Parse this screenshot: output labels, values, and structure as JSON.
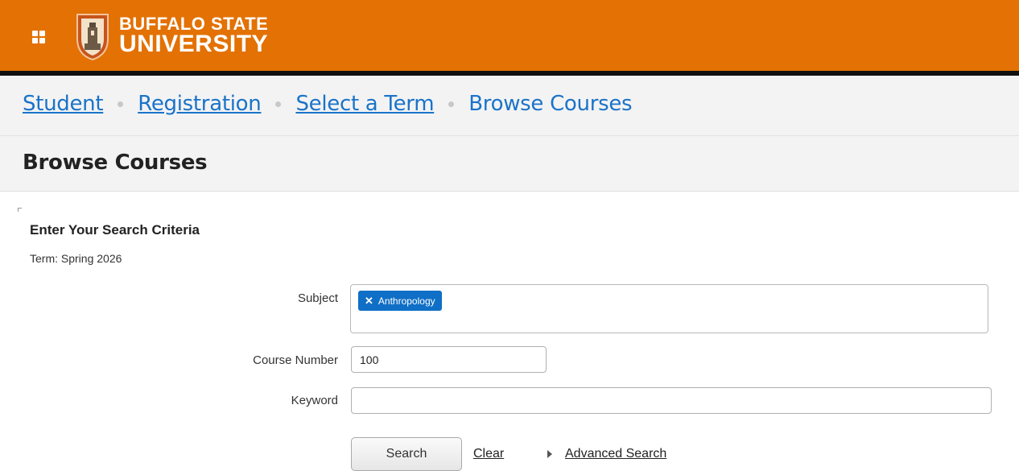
{
  "header": {
    "logo_line1": "BUFFALO STATE",
    "logo_line2": "UNIVERSITY",
    "icons": {
      "apps": "apps-grid-icon",
      "seal": "university-seal-icon"
    },
    "colors": {
      "brand": "#E37103",
      "rule": "#111111"
    }
  },
  "breadcrumb": {
    "items": [
      "Student",
      "Registration",
      "Select a Term"
    ],
    "current": "Browse Courses"
  },
  "page": {
    "title": "Browse Courses"
  },
  "form": {
    "section_title": "Enter Your Search Criteria",
    "term": "Term: Spring 2026",
    "subject": {
      "label": "Subject",
      "selected": [
        "Anthropology"
      ],
      "chip_color": "#0F6FC6"
    },
    "course_number": {
      "label": "Course Number",
      "value": "100"
    },
    "keyword": {
      "label": "Keyword",
      "value": ""
    },
    "buttons": {
      "search": "Search",
      "clear": "Clear",
      "advanced": "Advanced Search"
    }
  },
  "colors": {
    "link": "#1A73C9"
  }
}
